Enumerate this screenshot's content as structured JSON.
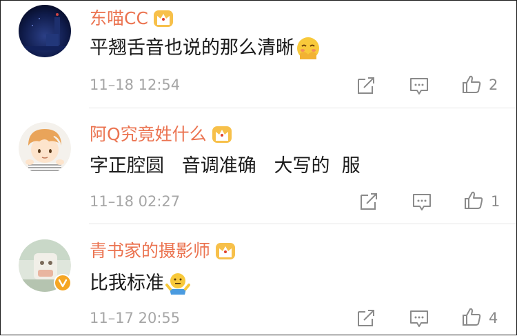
{
  "comments": [
    {
      "username": "东喵CC",
      "text": "平翘舌音也说的那么清晰",
      "emoji": "shy-face-emoji",
      "time": "11–18 12:54",
      "likes": "2"
    },
    {
      "username": "阿Q究竟姓什么",
      "text": "字正腔圆   音调准确   大写的  服",
      "emoji": "",
      "time": "11–18 02:27",
      "likes": "1"
    },
    {
      "username": "青书家的摄影师",
      "text": "比我标准",
      "emoji": "shrug-emoji",
      "time": "11–17 20:55",
      "likes": "4"
    }
  ],
  "colors": {
    "username": "#eb7350",
    "timestamp": "#a6a6a6",
    "crown": "#f5a623",
    "verified_badge": "#f5a623"
  },
  "icons": {
    "share": "share-icon",
    "comment": "comment-icon",
    "like": "thumbs-up-icon",
    "member": "crown-badge-icon"
  }
}
